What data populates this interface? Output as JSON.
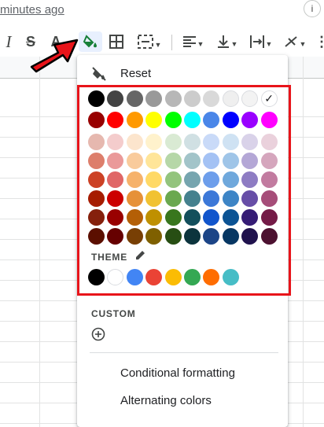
{
  "header": {
    "last_edit": "minutes ago"
  },
  "toolbar": {
    "italic": "I",
    "strike": "S",
    "text_color": "A",
    "items": [
      "italic-icon",
      "strikethrough-icon",
      "text-color-icon",
      "fill-color-icon",
      "borders-icon",
      "merge-cells-icon",
      "align-left-icon",
      "valign-bottom-icon",
      "text-wrap-icon",
      "text-rotation-icon"
    ]
  },
  "menu": {
    "reset_label": "Reset",
    "theme_label": "THEME",
    "custom_label": "CUSTOM",
    "conditional_label": "Conditional formatting",
    "alternating_label": "Alternating colors",
    "selected_color": "#ffffff",
    "palette": [
      [
        "#000000",
        "#434343",
        "#666666",
        "#999999",
        "#b7b7b7",
        "#cccccc",
        "#d9d9d9",
        "#efefef",
        "#f3f3f3",
        "#ffffff"
      ],
      [
        "#980000",
        "#ff0000",
        "#ff9900",
        "#ffff00",
        "#00ff00",
        "#00ffff",
        "#4a86e8",
        "#0000ff",
        "#9900ff",
        "#ff00ff"
      ],
      [
        "#e6b8af",
        "#f4cccc",
        "#fce5cd",
        "#fff2cc",
        "#d9ead3",
        "#d0e0e3",
        "#c9daf8",
        "#cfe2f3",
        "#d9d2e9",
        "#ead1dc"
      ],
      [
        "#dd7e6b",
        "#ea9999",
        "#f9cb9c",
        "#ffe599",
        "#b6d7a8",
        "#a2c4c9",
        "#a4c2f4",
        "#9fc5e8",
        "#b4a7d6",
        "#d5a6bd"
      ],
      [
        "#cc4125",
        "#e06666",
        "#f6b26b",
        "#ffd966",
        "#93c47d",
        "#76a5af",
        "#6d9eeb",
        "#6fa8dc",
        "#8e7cc3",
        "#c27ba0"
      ],
      [
        "#a61c00",
        "#cc0000",
        "#e69138",
        "#f1c232",
        "#6aa84f",
        "#45818e",
        "#3c78d8",
        "#3d85c6",
        "#674ea7",
        "#a64d79"
      ],
      [
        "#85200c",
        "#990000",
        "#b45f06",
        "#bf9000",
        "#38761d",
        "#134f5c",
        "#1155cc",
        "#0b5394",
        "#351c75",
        "#741b47"
      ],
      [
        "#5b0f00",
        "#660000",
        "#783f04",
        "#7f6000",
        "#274e13",
        "#0c343d",
        "#1c4587",
        "#073763",
        "#20124d",
        "#4c1130"
      ]
    ],
    "theme_colors": [
      "#000000",
      "#ffffff",
      "#4285f4",
      "#ea4335",
      "#fbbc04",
      "#34a853",
      "#ff6d01",
      "#46bdc6"
    ]
  },
  "colors": {
    "highlight_box": "#e8141a",
    "arrow": "#e8141a",
    "fill_icon_active": "#188038"
  }
}
